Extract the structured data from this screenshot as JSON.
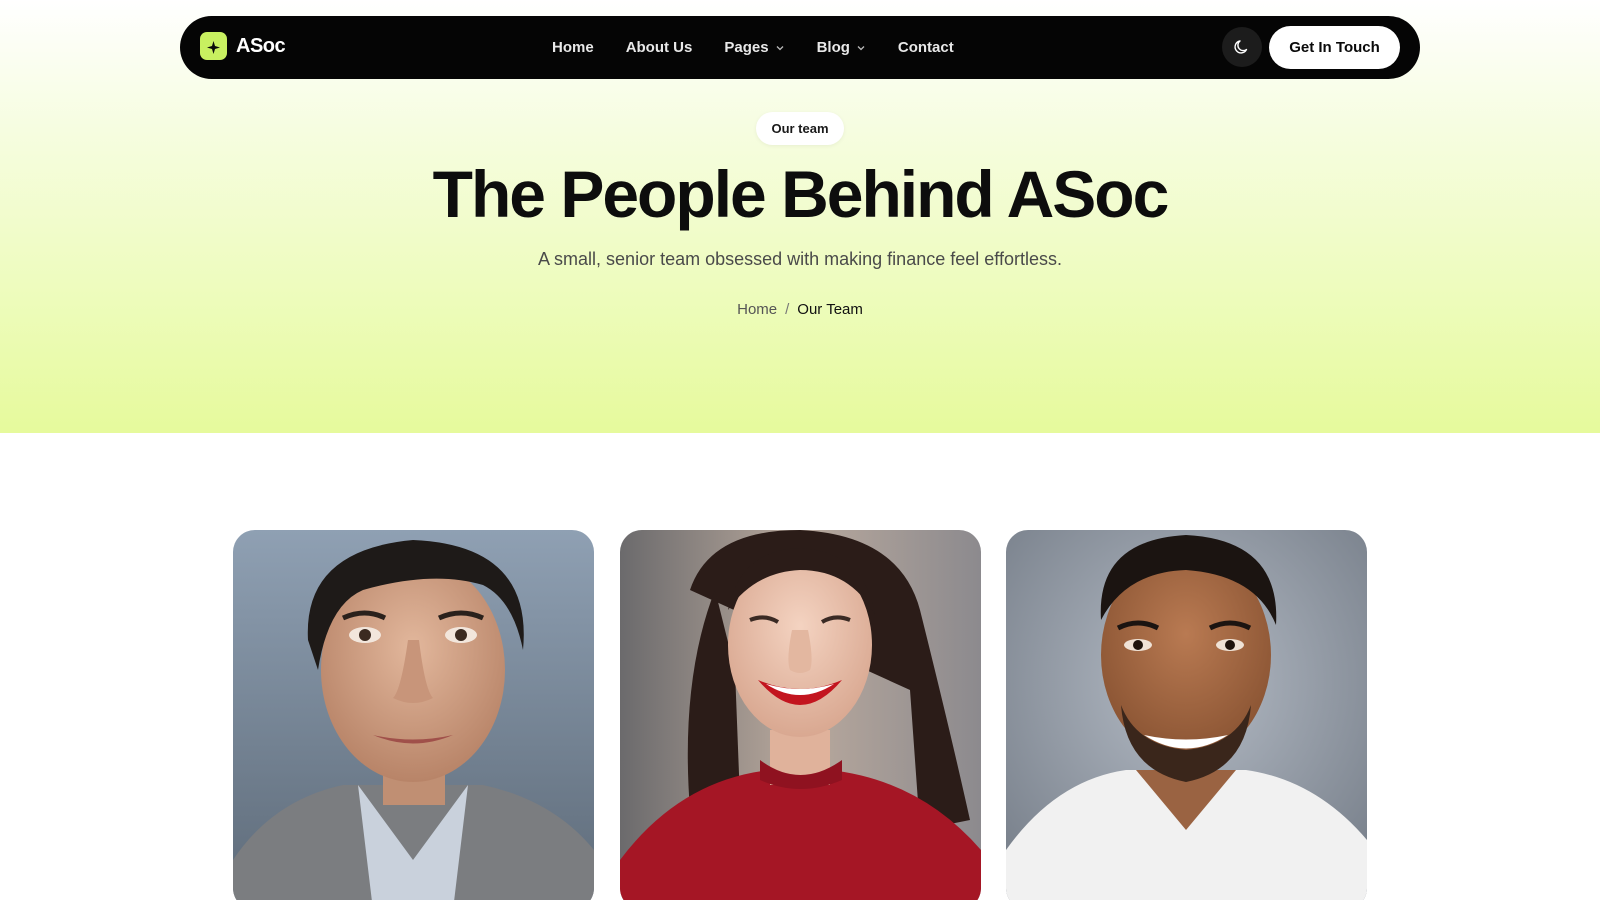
{
  "brand": {
    "name": "ASoc",
    "accent": "#c8f060"
  },
  "nav": {
    "items": [
      {
        "label": "Home",
        "dropdown": false
      },
      {
        "label": "About Us",
        "dropdown": false
      },
      {
        "label": "Pages",
        "dropdown": true
      },
      {
        "label": "Blog",
        "dropdown": true
      },
      {
        "label": "Contact",
        "dropdown": false
      }
    ],
    "theme_toggle_icon": "moon-icon",
    "cta_label": "Get In Touch"
  },
  "hero": {
    "badge": "Our team",
    "title": "The People Behind ASoc",
    "subtitle": "A small, senior team obsessed with making finance feel effortless.",
    "breadcrumb": {
      "home": "Home",
      "separator": "/",
      "current": "Our Team"
    }
  },
  "team": {
    "members": [
      {
        "photo": "man-dark-hair-grey-sweater-photo"
      },
      {
        "photo": "woman-smiling-red-top-photo"
      },
      {
        "photo": "man-smiling-white-tshirt-photo"
      }
    ]
  }
}
